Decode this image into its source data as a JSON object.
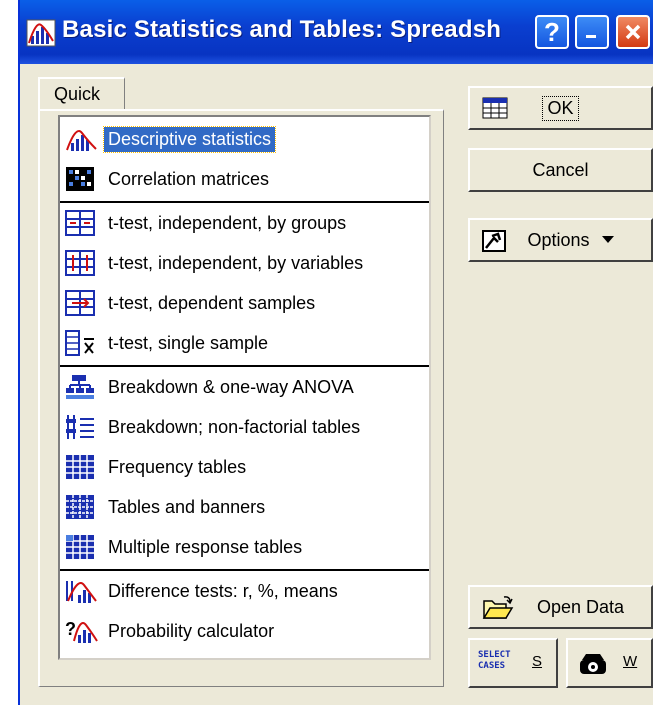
{
  "window": {
    "title": "Basic Statistics and Tables: Spreadsh",
    "help_label": "?",
    "minimize_label": "_",
    "close_label": "X"
  },
  "tab": {
    "label": "Quick"
  },
  "list": {
    "items": [
      {
        "label": "Descriptive statistics",
        "icon": "descriptive-stats-icon",
        "selected": true
      },
      {
        "label": "Correlation matrices",
        "icon": "correlation-matrix-icon"
      },
      {
        "label": "t-test, independent, by groups",
        "icon": "ttest-groups-icon"
      },
      {
        "label": "t-test, independent, by variables",
        "icon": "ttest-variables-icon"
      },
      {
        "label": "t-test, dependent samples",
        "icon": "ttest-dependent-icon"
      },
      {
        "label": "t-test, single sample",
        "icon": "ttest-single-icon"
      },
      {
        "label": "Breakdown & one-way ANOVA",
        "icon": "breakdown-anova-icon"
      },
      {
        "label": "Breakdown; non-factorial tables",
        "icon": "breakdown-nonfactorial-icon"
      },
      {
        "label": "Frequency tables",
        "icon": "frequency-table-icon"
      },
      {
        "label": "Tables and banners",
        "icon": "tables-banners-icon"
      },
      {
        "label": "Multiple response tables",
        "icon": "multiple-response-icon"
      },
      {
        "label": "Difference tests: r, %, means",
        "icon": "difference-tests-icon"
      },
      {
        "label": "Probability calculator",
        "icon": "probability-calculator-icon"
      }
    ]
  },
  "buttons": {
    "ok": "OK",
    "cancel": "Cancel",
    "options": "Options",
    "open_data": "Open Data",
    "select_cases_icon_text_1": "SELECT",
    "select_cases_icon_text_2": "CASES",
    "select_shortcut": "S",
    "weight_shortcut": "W"
  }
}
